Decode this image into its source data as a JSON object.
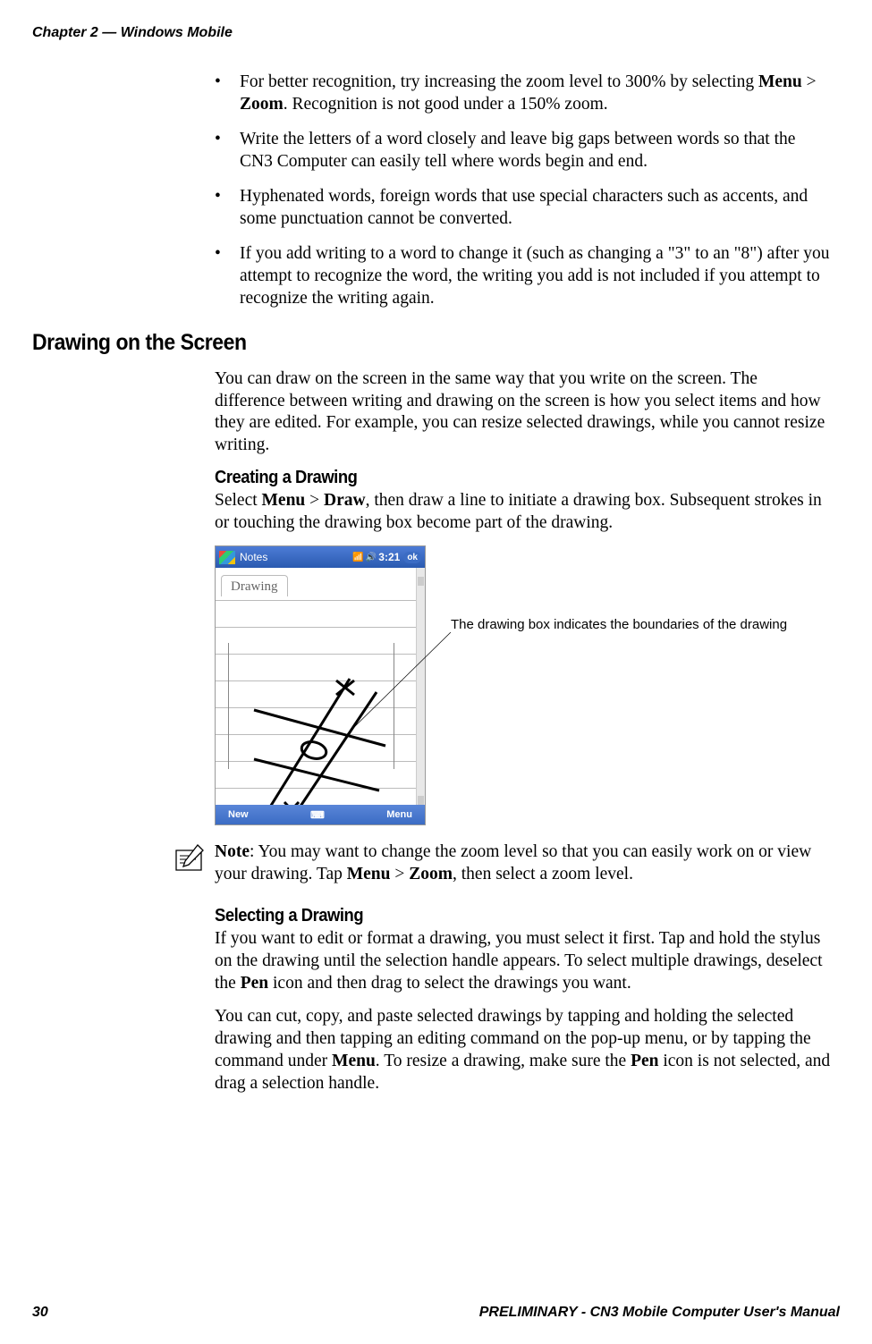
{
  "header": "Chapter 2 — Windows Mobile",
  "bullets": [
    "For better recognition, try increasing the zoom level to 300% by selecting <b>Menu</b> > <b>Zoom</b>. Recognition is not good under a 150% zoom.",
    "Write the letters of a word closely and leave big gaps between words so that the CN3 Computer can easily tell where words begin and end.",
    "Hyphenated words, foreign words that use special characters such as accents, and some punctuation cannot be converted.",
    "If you add writing to a word to change it (such as changing a \"3\" to an \"8\") after you attempt to recognize the word, the writing you add is not included if you attempt to recognize the writing again."
  ],
  "section_heading": "Drawing on the Screen",
  "section_body": "You can draw on the screen in the same way that you write on the screen. The difference between writing and drawing on the screen is how you select items and how they are edited. For example, you can resize selected drawings, while you cannot resize writing.",
  "sub1_heading": "Creating a Drawing",
  "sub1_body": "Select <b>Menu</b> > <b>Draw</b>, then draw a line to initiate a drawing box. Subsequent strokes in or touching the drawing box become part of the drawing.",
  "screenshot": {
    "app_title": "Notes",
    "time": "3:21",
    "ok": "ok",
    "tab": "Drawing",
    "toolbar_new": "New",
    "toolbar_menu": "Menu"
  },
  "annotation": "The drawing box indicates the boundaries of the drawing",
  "note_text": "<b>Note</b>: You may want to change the zoom level so that you can easily work on or view your drawing. Tap <b>Menu</b> > <b>Zoom</b>, then select a zoom level.",
  "sub2_heading": "Selecting a Drawing",
  "sub2_body1": "If you want to edit or format a drawing, you must select it first. Tap and hold the stylus on the drawing until the selection handle appears. To select multiple drawings, deselect the <b>Pen</b> icon and then drag to select the drawings you want.",
  "sub2_body2": "You can cut, copy, and paste selected drawings by tapping and holding the selected drawing and then tapping an editing command on the pop-up menu, or by tapping the command under <b>Menu</b>. To resize a drawing, make sure the <b>Pen</b> icon is not selected, and drag a selection handle.",
  "footer_left": "30",
  "footer_right": "PRELIMINARY - CN3 Mobile Computer User's Manual"
}
